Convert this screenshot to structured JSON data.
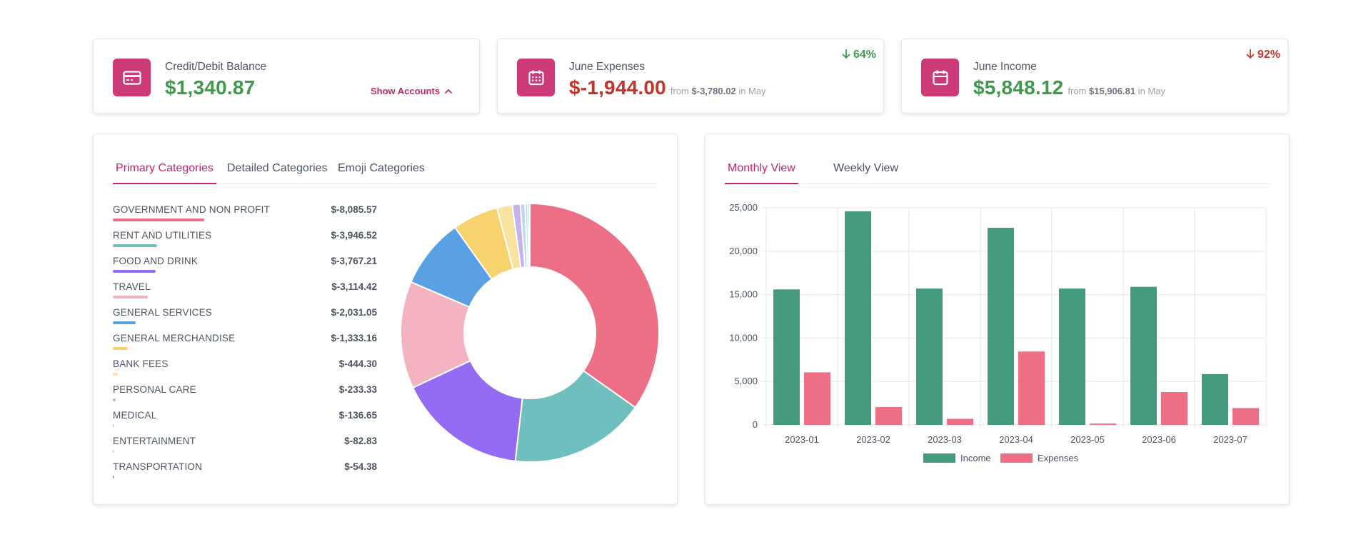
{
  "balance": {
    "label": "Credit/Debit Balance",
    "amount": "$1,340.87",
    "show_accounts": "Show Accounts",
    "icon": "credit-card-icon"
  },
  "expenses": {
    "label": "June Expenses",
    "amount": "$-1,944.00",
    "from_prefix": "from",
    "from_value": "$-3,780.02",
    "from_suffix": "in May",
    "change": "64%",
    "icon": "calendar-grid-icon"
  },
  "income": {
    "label": "June Income",
    "amount": "$5,848.12",
    "from_prefix": "from",
    "from_value": "$15,906.81",
    "from_suffix": "in May",
    "change": "92%",
    "icon": "calendar-icon"
  },
  "category_tabs": [
    "Primary Categories",
    "Detailed Categories",
    "Emoji Categories"
  ],
  "view_tabs": [
    "Monthly View",
    "Weekly View"
  ],
  "categories": [
    {
      "name": "GOVERNMENT AND NON PROFIT",
      "value": "$-8,085.57",
      "amount": 8085.57,
      "color": "#ec6f85"
    },
    {
      "name": "RENT AND UTILITIES",
      "value": "$-3,946.52",
      "amount": 3946.52,
      "color": "#6fbfbe"
    },
    {
      "name": "FOOD AND DRINK",
      "value": "$-3,767.21",
      "amount": 3767.21,
      "color": "#946cf3"
    },
    {
      "name": "TRAVEL",
      "value": "$-3,114.42",
      "amount": 3114.42,
      "color": "#f4b3c1"
    },
    {
      "name": "GENERAL SERVICES",
      "value": "$-2,031.05",
      "amount": 2031.05,
      "color": "#59a0e5"
    },
    {
      "name": "GENERAL MERCHANDISE",
      "value": "$-1,333.16",
      "amount": 1333.16,
      "color": "#f6d36d"
    },
    {
      "name": "BANK FEES",
      "value": "$-444.30",
      "amount": 444.3,
      "color": "#fae29f"
    },
    {
      "name": "PERSONAL CARE",
      "value": "$-233.33",
      "amount": 233.33,
      "color": "#c4b2ee"
    },
    {
      "name": "MEDICAL",
      "value": "$-136.65",
      "amount": 136.65,
      "color": "#b7d8f4"
    },
    {
      "name": "ENTERTAINMENT",
      "value": "$-82.83",
      "amount": 82.83,
      "color": "#bde3e0"
    },
    {
      "name": "TRANSPORTATION",
      "value": "$-54.38",
      "amount": 54.38,
      "color": "#9bb0c8"
    }
  ],
  "chart_data": {
    "type": "bar",
    "categories": [
      "2023-01",
      "2023-02",
      "2023-03",
      "2023-04",
      "2023-05",
      "2023-06",
      "2023-07"
    ],
    "series": [
      {
        "name": "Income",
        "color": "#439b7c",
        "values": [
          15600,
          24600,
          15700,
          22700,
          15700,
          15900,
          5850
        ]
      },
      {
        "name": "Expenses",
        "color": "#ec6f85",
        "values": [
          6050,
          2050,
          700,
          8450,
          150,
          3780,
          1940
        ]
      }
    ],
    "ylim": [
      0,
      25000
    ],
    "yticks": [
      "0",
      "5,000",
      "10,000",
      "15,000",
      "20,000",
      "25,000"
    ],
    "grid": true,
    "legend": "bottom"
  }
}
